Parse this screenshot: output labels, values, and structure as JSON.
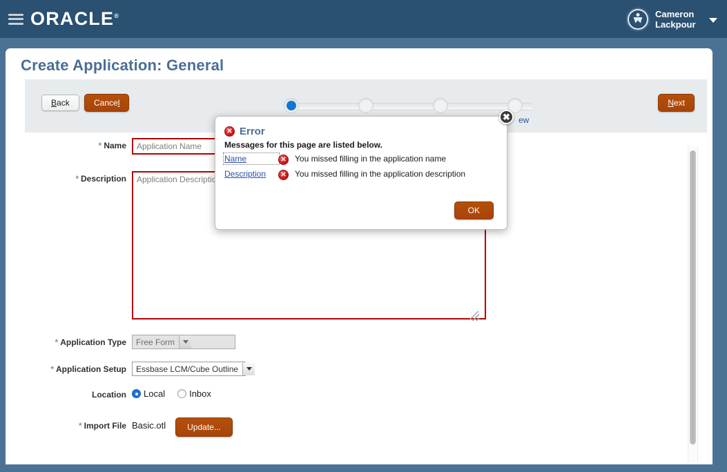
{
  "header": {
    "menu_icon": "hamburger-menu-icon",
    "logo_text": "ORACLE",
    "logo_tm": "®",
    "user_icon": "user-accessibility-icon",
    "user_name_line1": "Cameron",
    "user_name_line2": "Lackpour",
    "caret_icon": "chevron-down-icon"
  },
  "page": {
    "title": "Create Application: General"
  },
  "toolbar": {
    "back_label": "Back",
    "cancel_label": "Cancel",
    "next_label": "Next"
  },
  "train": {
    "steps": [
      {
        "label": "",
        "state": "current"
      },
      {
        "label": "",
        "state": "pending"
      },
      {
        "label": "",
        "state": "pending"
      },
      {
        "label": "ew",
        "state": "pending"
      }
    ]
  },
  "form": {
    "name": {
      "label": "Name",
      "required": true,
      "value": "",
      "placeholder": "Application Name",
      "has_error": true
    },
    "description": {
      "label": "Description",
      "required": true,
      "value": "",
      "placeholder": "Application Description",
      "has_error": true
    },
    "application_type": {
      "label": "Application Type",
      "required": true,
      "value": "Free Form",
      "disabled": true
    },
    "application_setup": {
      "label": "Application Setup",
      "required": true,
      "value": "Essbase LCM/Cube Outline",
      "disabled": false
    },
    "location": {
      "label": "Location",
      "required": false,
      "options": [
        {
          "label": "Local",
          "selected": true
        },
        {
          "label": "Inbox",
          "selected": false
        }
      ]
    },
    "import_file": {
      "label": "Import File",
      "required": true,
      "filename": "Basic.otl",
      "button_label": "Update..."
    }
  },
  "error_dialog": {
    "icon": "error-circle-x-icon",
    "title": "Error",
    "subtitle": "Messages for this page are listed below.",
    "close_icon": "close-x-icon",
    "ok_label": "OK",
    "messages": [
      {
        "link": "Name",
        "text": "You missed filling in the application name",
        "focused": true
      },
      {
        "link": "Description",
        "text": "You missed filling in the application description",
        "focused": false
      }
    ]
  },
  "colors": {
    "header_bg": "#2a5072",
    "page_bg": "#4a7294",
    "title_blue": "#4a6e96",
    "primary_button": "#ad470a",
    "error_red": "#b50000",
    "train_active": "#1177d1",
    "link_blue": "#2a4ea8"
  },
  "scrollbar": {
    "orientation": "vertical"
  }
}
